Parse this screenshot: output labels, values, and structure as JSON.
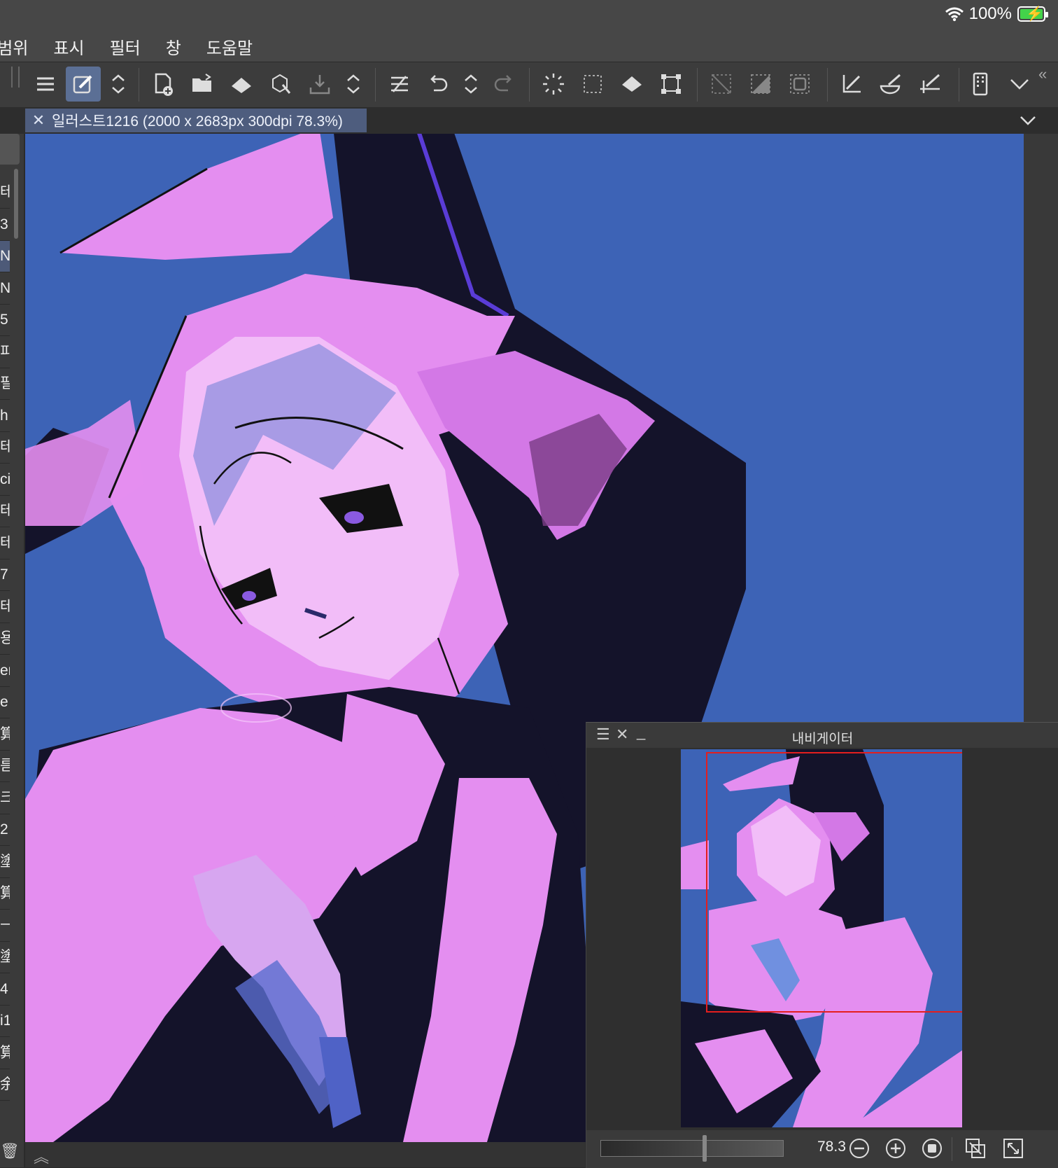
{
  "status_bar": {
    "battery_percent": "100%",
    "wifi_icon": "wifi-icon",
    "battery_icon": "battery-charging-icon"
  },
  "menu": {
    "items": [
      "범위",
      "표시",
      "필터",
      "창",
      "도움말"
    ]
  },
  "toolbar": {
    "tools": [
      "menu-icon",
      "tool-property-icon",
      "expand-icon",
      "new-canvas-icon",
      "open-folder-icon",
      "fill-icon",
      "3d-select-icon",
      "export-icon",
      "expand-icon",
      "layer-icon",
      "undo-icon",
      "expand-icon",
      "redo-icon",
      "loading-icon",
      "select-all-icon",
      "fill-selection-icon",
      "transform-icon",
      "deselect-icon",
      "invert-selection-icon",
      "selection-border-icon",
      "ruler-icon",
      "brush-bowl-icon",
      "perspective-ruler-icon",
      "device-icon",
      "chevron-down-icon"
    ],
    "collapse_icon": "double-chevron-left-icon"
  },
  "document": {
    "tab_title": "일러스트1216 (2000 x 2683px 300dpi 78.3%)",
    "close_icon": "close-icon"
  },
  "left_strip": {
    "items": [
      "테",
      "3",
      "N",
      "N",
      "5",
      "피",
      "필",
      "h",
      "테",
      "cil",
      "테",
      "테",
      "7",
      "테",
      "용",
      "er",
      "e",
      "算",
      "름",
      "크",
      "2",
      "塗",
      "算",
      "ㅡ",
      "塗",
      "4",
      "i1",
      "算",
      "余"
    ],
    "selected_index": 2
  },
  "navigator": {
    "title": "내비게이터",
    "zoom_value": "78.3",
    "buttons": [
      "zoom-out-icon",
      "zoom-in-icon",
      "stop-icon",
      "fit-icon",
      "fullscreen-icon"
    ]
  },
  "colors": {
    "canvas_bg": "#3d63b6",
    "pink": "#e48ef0",
    "dark": "#14132a",
    "accent_tab": "#4e5d7e",
    "nav_rect": "#e41e1e"
  }
}
